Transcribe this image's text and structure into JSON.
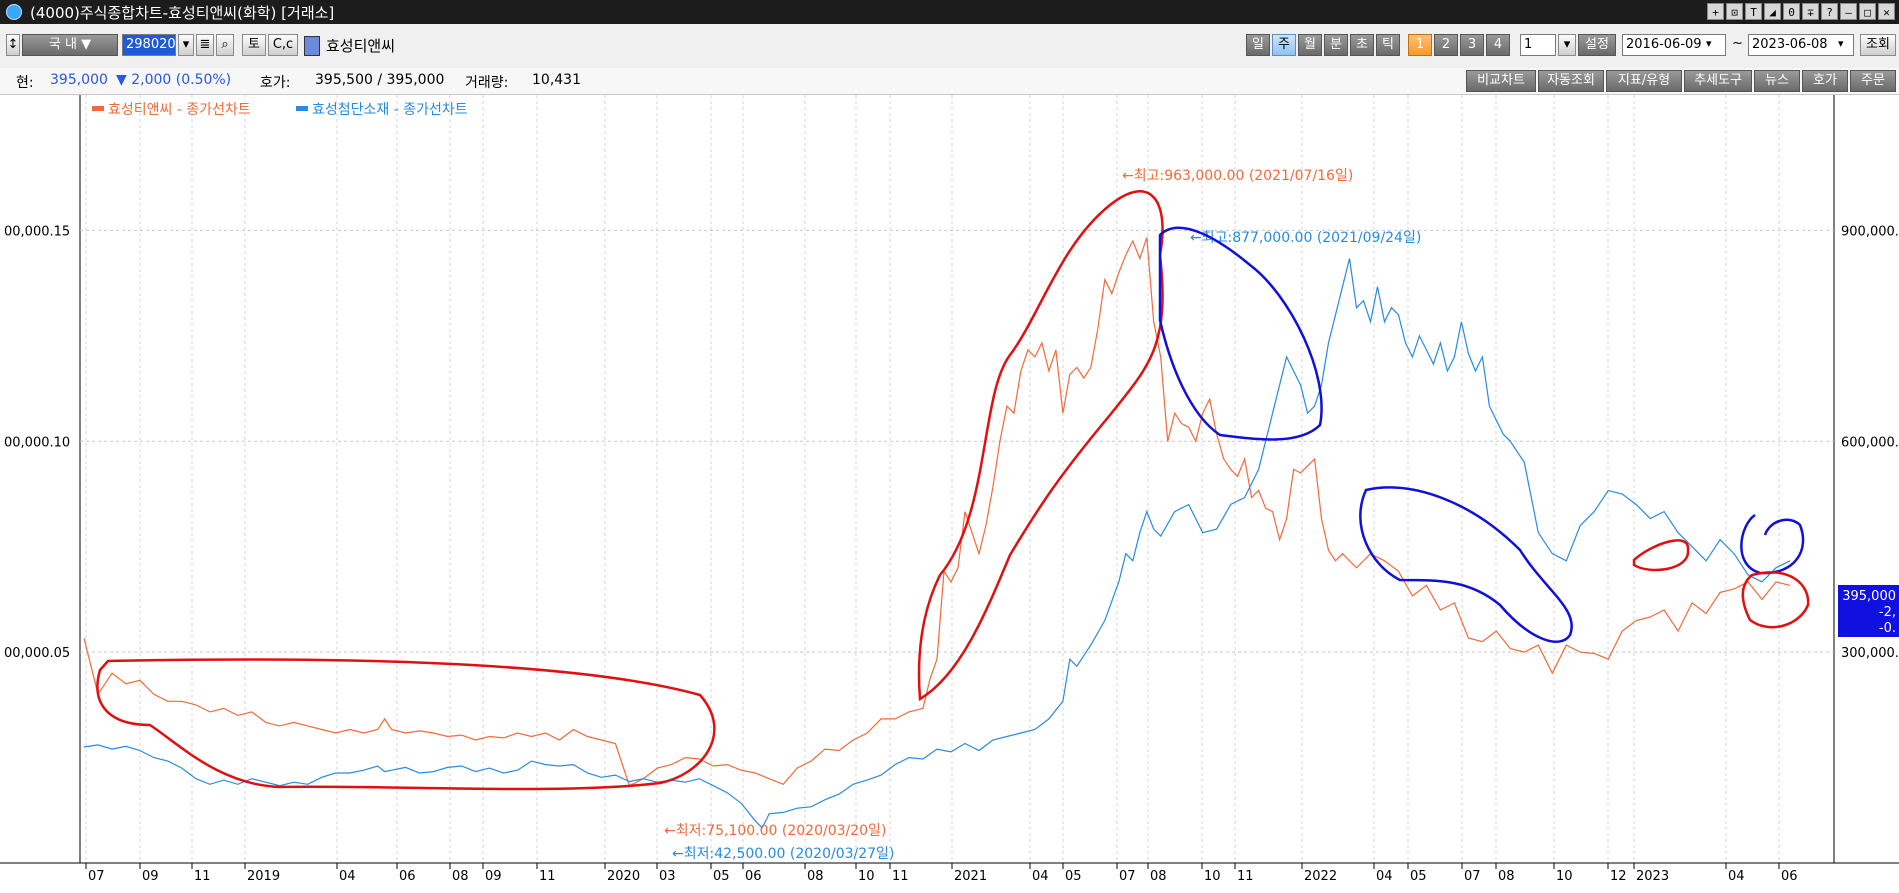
{
  "window": {
    "title": "(4000)주식종합차트-효성티앤씨(화학) [거래소]"
  },
  "toolbar": {
    "market_label": "국  내",
    "code": "298020",
    "btn_to": "토",
    "btn_cc": "C,c",
    "stock_name": "효성티앤씨",
    "period_buttons": [
      "일",
      "주",
      "월",
      "분",
      "초",
      "틱"
    ],
    "num_buttons": [
      "1",
      "2",
      "3",
      "4"
    ],
    "interval_value": "1",
    "settings_label": "설정",
    "start_date": "2016-06-09",
    "date_sep": "~",
    "end_date": "2023-06-08",
    "query_label": "조회"
  },
  "info": {
    "cur_label": "현:",
    "cur_value": "395,000",
    "change": "▼ 2,000 (0.50%)",
    "quote_label": "호가:",
    "quote_value": "395,500 / 395,000",
    "volume_label": "거래량:",
    "volume_value": "10,431",
    "right_buttons": [
      "비교차트",
      "자동조회",
      "지표/유형",
      "추세도구",
      "뉴스",
      "호가",
      "주문"
    ]
  },
  "chart_data": {
    "type": "line",
    "x_tick_labels": [
      "07",
      "09",
      "11",
      "2019",
      "04",
      "06",
      "08",
      "09",
      "11",
      "2020",
      "03",
      "05",
      "06",
      "08",
      "10",
      "11",
      "2021",
      "04",
      "05",
      "07",
      "08",
      "10",
      "11",
      "2022",
      "04",
      "05",
      "07",
      "08",
      "10",
      "12",
      "2023",
      "04",
      "06"
    ],
    "left_axis_labels": [
      "00,000.15",
      "00,000.10",
      "00,000.05"
    ],
    "right_axis_labels": [
      "900,000.",
      "600,000.",
      "300,000."
    ],
    "series": [
      {
        "name": "효성티앤씨 - 종가선차트",
        "color": "#f26a3a",
        "max_label": "←최고:963,000.00 (2021/07/16일)",
        "min_label": "←최저:75,100.00 (2020/03/20일)",
        "points": [
          [
            0,
            320
          ],
          [
            10,
            240
          ],
          [
            20,
            270
          ],
          [
            30,
            255
          ],
          [
            40,
            260
          ],
          [
            50,
            240
          ],
          [
            60,
            230
          ],
          [
            70,
            230
          ],
          [
            80,
            225
          ],
          [
            90,
            215
          ],
          [
            100,
            220
          ],
          [
            110,
            210
          ],
          [
            120,
            215
          ],
          [
            130,
            200
          ],
          [
            140,
            195
          ],
          [
            150,
            200
          ],
          [
            160,
            195
          ],
          [
            170,
            190
          ],
          [
            180,
            185
          ],
          [
            190,
            190
          ],
          [
            200,
            185
          ],
          [
            210,
            190
          ],
          [
            215,
            205
          ],
          [
            220,
            190
          ],
          [
            230,
            185
          ],
          [
            240,
            188
          ],
          [
            250,
            185
          ],
          [
            260,
            180
          ],
          [
            270,
            182
          ],
          [
            280,
            175
          ],
          [
            290,
            180
          ],
          [
            300,
            178
          ],
          [
            310,
            185
          ],
          [
            320,
            180
          ],
          [
            330,
            185
          ],
          [
            340,
            175
          ],
          [
            350,
            190
          ],
          [
            360,
            180
          ],
          [
            370,
            175
          ],
          [
            380,
            170
          ],
          [
            390,
            110
          ],
          [
            400,
            120
          ],
          [
            410,
            135
          ],
          [
            420,
            140
          ],
          [
            430,
            150
          ],
          [
            440,
            148
          ],
          [
            450,
            138
          ],
          [
            460,
            140
          ],
          [
            470,
            132
          ],
          [
            480,
            128
          ],
          [
            490,
            120
          ],
          [
            500,
            112
          ],
          [
            510,
            135
          ],
          [
            520,
            145
          ],
          [
            530,
            162
          ],
          [
            540,
            160
          ],
          [
            550,
            175
          ],
          [
            560,
            185
          ],
          [
            570,
            205
          ],
          [
            580,
            205
          ],
          [
            590,
            215
          ],
          [
            600,
            220
          ],
          [
            605,
            262
          ],
          [
            610,
            290
          ],
          [
            615,
            415
          ],
          [
            620,
            400
          ],
          [
            625,
            420
          ],
          [
            630,
            500
          ],
          [
            640,
            440
          ],
          [
            645,
            480
          ],
          [
            650,
            535
          ],
          [
            655,
            600
          ],
          [
            660,
            650
          ],
          [
            665,
            640
          ],
          [
            670,
            700
          ],
          [
            675,
            730
          ],
          [
            680,
            720
          ],
          [
            685,
            740
          ],
          [
            690,
            700
          ],
          [
            695,
            730
          ],
          [
            700,
            640
          ],
          [
            705,
            695
          ],
          [
            710,
            705
          ],
          [
            715,
            690
          ],
          [
            720,
            705
          ],
          [
            725,
            760
          ],
          [
            730,
            830
          ],
          [
            735,
            810
          ],
          [
            740,
            840
          ],
          [
            745,
            865
          ],
          [
            750,
            885
          ],
          [
            755,
            860
          ],
          [
            760,
            890
          ],
          [
            765,
            770
          ],
          [
            770,
            720
          ],
          [
            775,
            600
          ],
          [
            780,
            640
          ],
          [
            785,
            625
          ],
          [
            790,
            620
          ],
          [
            795,
            600
          ],
          [
            800,
            640
          ],
          [
            805,
            660
          ],
          [
            810,
            610
          ],
          [
            815,
            575
          ],
          [
            820,
            560
          ],
          [
            825,
            550
          ],
          [
            830,
            575
          ],
          [
            835,
            520
          ],
          [
            840,
            530
          ],
          [
            845,
            505
          ],
          [
            850,
            500
          ],
          [
            855,
            460
          ],
          [
            860,
            490
          ],
          [
            865,
            560
          ],
          [
            870,
            555
          ],
          [
            875,
            565
          ],
          [
            880,
            575
          ],
          [
            885,
            490
          ],
          [
            890,
            445
          ],
          [
            895,
            430
          ],
          [
            900,
            440
          ],
          [
            910,
            420
          ],
          [
            920,
            440
          ],
          [
            930,
            430
          ],
          [
            940,
            415
          ],
          [
            950,
            380
          ],
          [
            960,
            395
          ],
          [
            970,
            360
          ],
          [
            980,
            370
          ],
          [
            990,
            320
          ],
          [
            1000,
            315
          ],
          [
            1010,
            330
          ],
          [
            1020,
            305
          ],
          [
            1030,
            300
          ],
          [
            1040,
            310
          ],
          [
            1050,
            270
          ],
          [
            1060,
            310
          ],
          [
            1070,
            300
          ],
          [
            1080,
            298
          ],
          [
            1090,
            290
          ],
          [
            1100,
            330
          ],
          [
            1110,
            345
          ],
          [
            1120,
            350
          ],
          [
            1130,
            360
          ],
          [
            1140,
            330
          ],
          [
            1150,
            370
          ],
          [
            1160,
            355
          ],
          [
            1170,
            385
          ],
          [
            1180,
            390
          ],
          [
            1190,
            400
          ],
          [
            1200,
            375
          ],
          [
            1210,
            400
          ],
          [
            1220,
            395
          ]
        ]
      },
      {
        "name": "효성첨단소재 - 종가선차트",
        "color": "#2a8ae0",
        "max_label": "←최고:877,000.00 (2021/09/24일)",
        "min_label": "←최저:42,500.00 (2020/03/27일)",
        "points": [
          [
            0,
            165
          ],
          [
            10,
            168
          ],
          [
            20,
            162
          ],
          [
            30,
            166
          ],
          [
            40,
            160
          ],
          [
            50,
            150
          ],
          [
            60,
            145
          ],
          [
            70,
            135
          ],
          [
            80,
            120
          ],
          [
            90,
            112
          ],
          [
            100,
            118
          ],
          [
            110,
            112
          ],
          [
            120,
            120
          ],
          [
            130,
            115
          ],
          [
            140,
            110
          ],
          [
            150,
            115
          ],
          [
            160,
            112
          ],
          [
            170,
            122
          ],
          [
            180,
            128
          ],
          [
            190,
            128
          ],
          [
            200,
            132
          ],
          [
            210,
            138
          ],
          [
            215,
            130
          ],
          [
            220,
            132
          ],
          [
            230,
            136
          ],
          [
            240,
            128
          ],
          [
            250,
            130
          ],
          [
            260,
            136
          ],
          [
            270,
            138
          ],
          [
            280,
            130
          ],
          [
            290,
            135
          ],
          [
            300,
            128
          ],
          [
            310,
            132
          ],
          [
            320,
            145
          ],
          [
            330,
            140
          ],
          [
            340,
            138
          ],
          [
            350,
            140
          ],
          [
            360,
            128
          ],
          [
            370,
            122
          ],
          [
            380,
            125
          ],
          [
            390,
            116
          ],
          [
            400,
            120
          ],
          [
            410,
            115
          ],
          [
            420,
            118
          ],
          [
            430,
            115
          ],
          [
            440,
            120
          ],
          [
            450,
            110
          ],
          [
            460,
            100
          ],
          [
            470,
            85
          ],
          [
            480,
            60
          ],
          [
            485,
            50
          ],
          [
            490,
            70
          ],
          [
            500,
            72
          ],
          [
            510,
            78
          ],
          [
            520,
            80
          ],
          [
            530,
            90
          ],
          [
            540,
            98
          ],
          [
            550,
            112
          ],
          [
            560,
            118
          ],
          [
            570,
            125
          ],
          [
            580,
            140
          ],
          [
            590,
            150
          ],
          [
            600,
            148
          ],
          [
            610,
            162
          ],
          [
            620,
            158
          ],
          [
            630,
            170
          ],
          [
            640,
            160
          ],
          [
            650,
            175
          ],
          [
            660,
            180
          ],
          [
            670,
            185
          ],
          [
            680,
            190
          ],
          [
            690,
            205
          ],
          [
            700,
            230
          ],
          [
            705,
            290
          ],
          [
            710,
            280
          ],
          [
            720,
            310
          ],
          [
            730,
            345
          ],
          [
            740,
            400
          ],
          [
            745,
            440
          ],
          [
            750,
            430
          ],
          [
            755,
            470
          ],
          [
            760,
            500
          ],
          [
            765,
            475
          ],
          [
            770,
            465
          ],
          [
            780,
            500
          ],
          [
            790,
            510
          ],
          [
            800,
            470
          ],
          [
            810,
            475
          ],
          [
            820,
            510
          ],
          [
            830,
            520
          ],
          [
            840,
            560
          ],
          [
            845,
            600
          ],
          [
            850,
            640
          ],
          [
            855,
            680
          ],
          [
            860,
            720
          ],
          [
            865,
            700
          ],
          [
            870,
            680
          ],
          [
            875,
            640
          ],
          [
            880,
            650
          ],
          [
            885,
            680
          ],
          [
            890,
            740
          ],
          [
            895,
            780
          ],
          [
            900,
            820
          ],
          [
            905,
            860
          ],
          [
            910,
            790
          ],
          [
            915,
            800
          ],
          [
            920,
            770
          ],
          [
            925,
            820
          ],
          [
            930,
            770
          ],
          [
            935,
            790
          ],
          [
            940,
            780
          ],
          [
            945,
            740
          ],
          [
            950,
            720
          ],
          [
            955,
            750
          ],
          [
            960,
            730
          ],
          [
            965,
            710
          ],
          [
            970,
            740
          ],
          [
            975,
            700
          ],
          [
            980,
            720
          ],
          [
            985,
            770
          ],
          [
            990,
            725
          ],
          [
            995,
            700
          ],
          [
            1000,
            720
          ],
          [
            1005,
            650
          ],
          [
            1010,
            630
          ],
          [
            1015,
            610
          ],
          [
            1020,
            600
          ],
          [
            1030,
            570
          ],
          [
            1040,
            470
          ],
          [
            1050,
            440
          ],
          [
            1060,
            430
          ],
          [
            1070,
            480
          ],
          [
            1080,
            500
          ],
          [
            1090,
            530
          ],
          [
            1100,
            525
          ],
          [
            1110,
            510
          ],
          [
            1120,
            490
          ],
          [
            1130,
            500
          ],
          [
            1140,
            470
          ],
          [
            1150,
            450
          ],
          [
            1160,
            430
          ],
          [
            1170,
            460
          ],
          [
            1180,
            440
          ],
          [
            1190,
            410
          ],
          [
            1200,
            400
          ],
          [
            1210,
            420
          ],
          [
            1220,
            430
          ]
        ]
      }
    ],
    "current_price_label": [
      "395,000",
      "-2,",
      "-0."
    ]
  }
}
